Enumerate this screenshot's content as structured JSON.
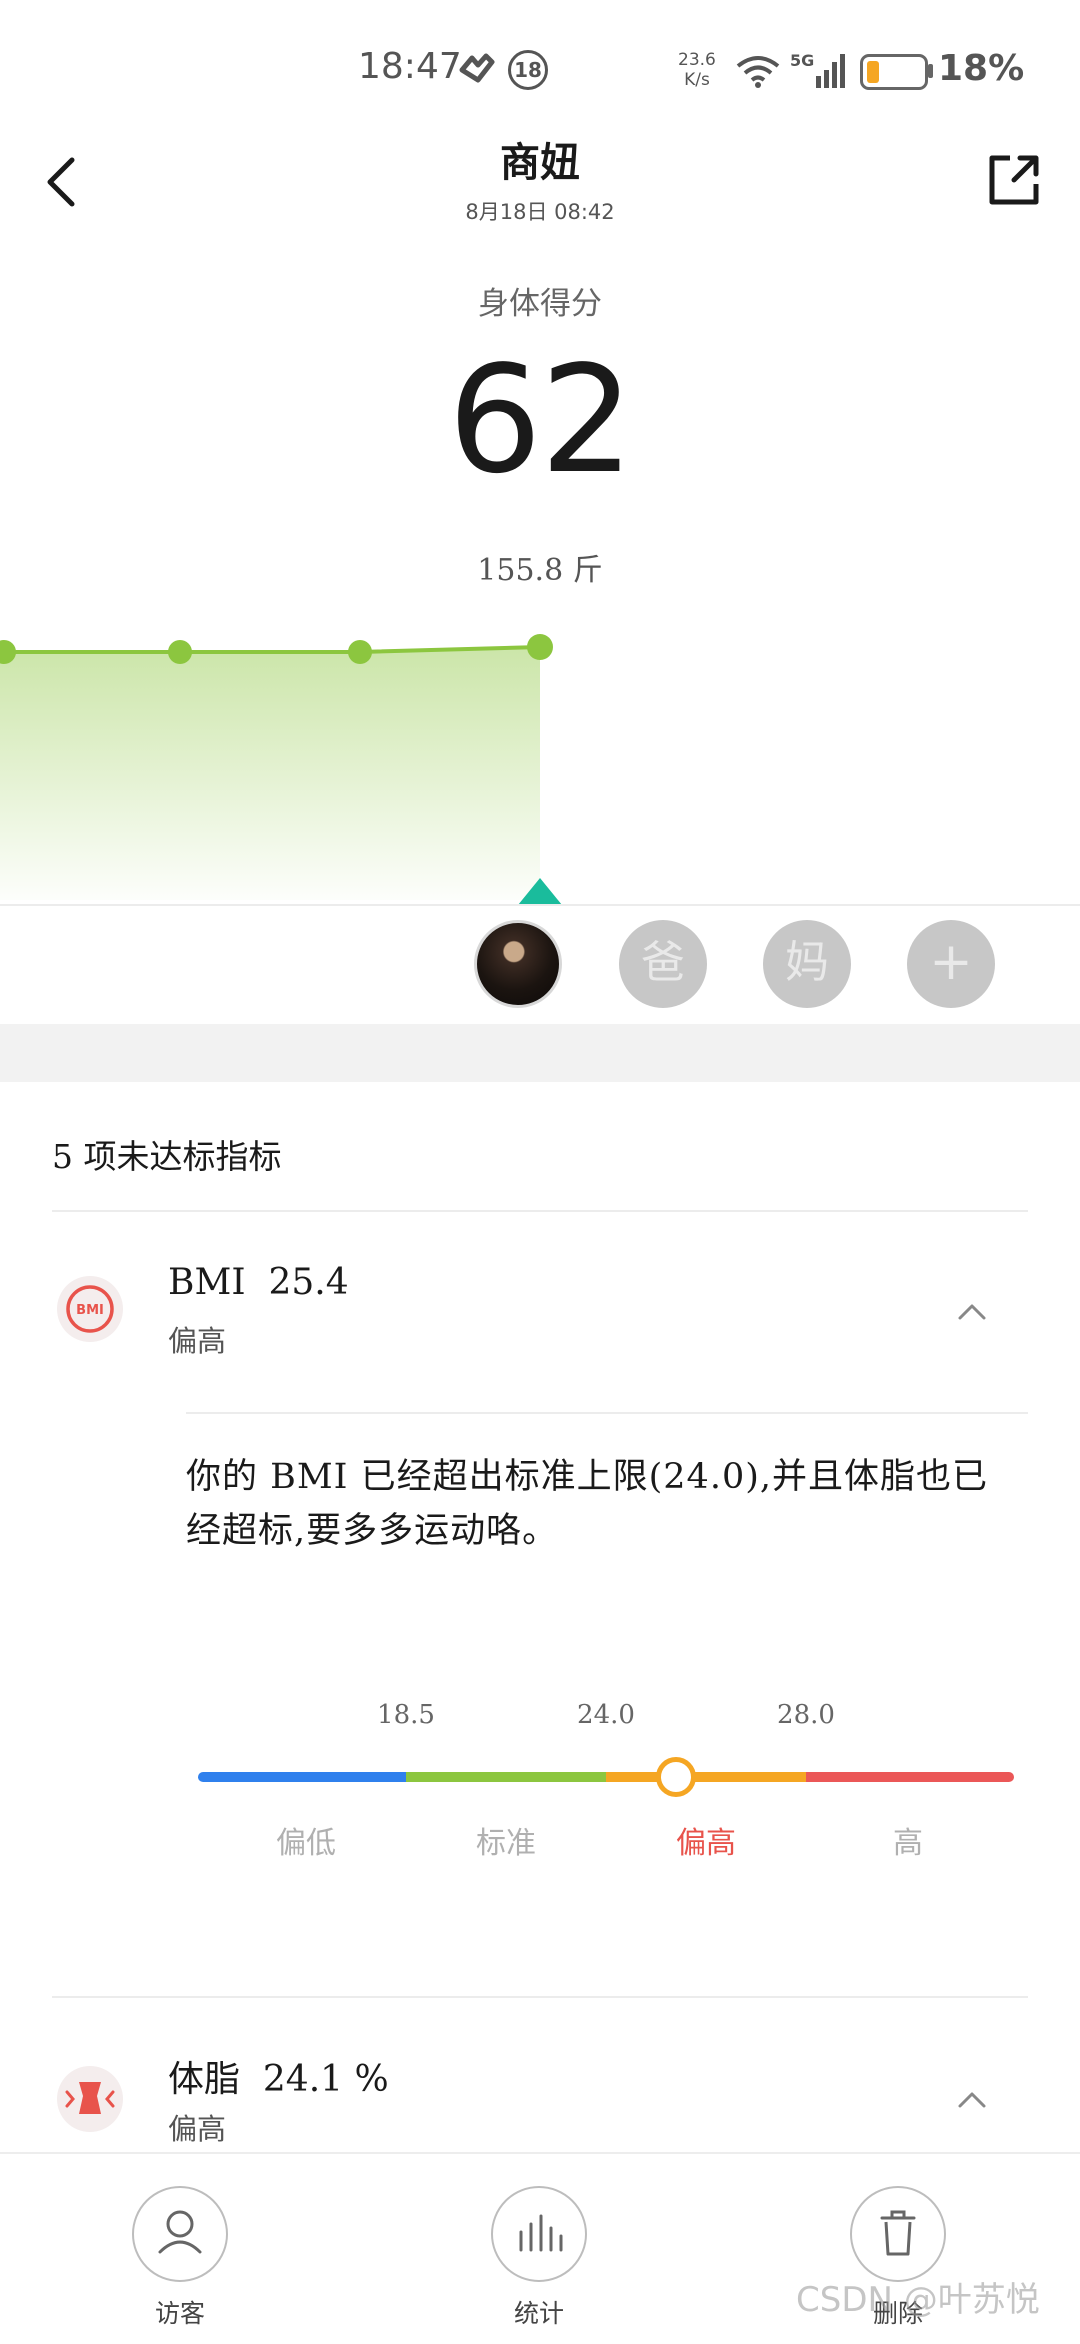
{
  "status_bar": {
    "time": "18:47",
    "notification_count": "18",
    "net_speed_value": "23.6",
    "net_speed_unit": "K/s",
    "network_type": "5G",
    "battery_percent": "18%",
    "battery_level": 0.18
  },
  "header": {
    "title": "商妞",
    "subtitle": "8月18日 08:42"
  },
  "score": {
    "label": "身体得分",
    "value": "62",
    "weight": "155.8 斤"
  },
  "weight_chart": {
    "type": "line",
    "line_color": "#8cc63f"
  },
  "users": {
    "dad": "爸",
    "mom": "妈",
    "add": "+"
  },
  "section": {
    "title": "5 项未达标指标"
  },
  "metrics": [
    {
      "icon": "bmi-icon",
      "icon_text": "BMI",
      "name": "BMI",
      "value": "25.4",
      "status": "偏高",
      "advice": "你的 BMI 已经超出标准上限(24.0),并且体脂也已经超标,要多多运动咯。",
      "scale_ticks": [
        "18.5",
        "24.0",
        "28.0"
      ],
      "scale_labels": [
        "偏低",
        "标准",
        "偏高",
        "高"
      ],
      "scale_colors": [
        "#2f80ed",
        "#8cc63f",
        "#f5a623",
        "#eb5757"
      ],
      "active_label_color": "#e8534b"
    },
    {
      "icon": "body-fat-icon",
      "name": "体脂",
      "value": "24.1 %",
      "status": "偏高"
    }
  ],
  "bottom_nav": {
    "visitor": "访客",
    "stats": "统计",
    "delete": "删除"
  },
  "watermark": "CSDN @叶苏悦"
}
